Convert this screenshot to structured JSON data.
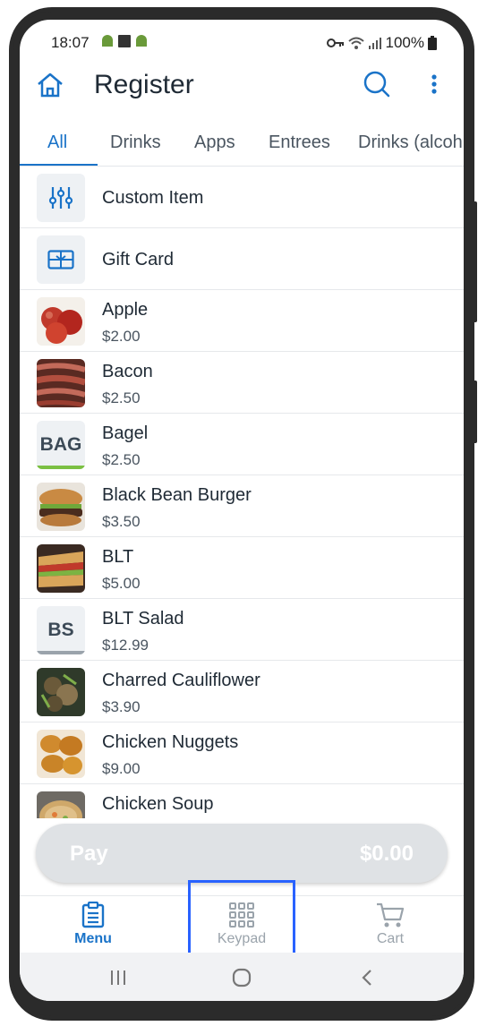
{
  "status_bar": {
    "time": "18:07",
    "battery": "100%"
  },
  "header": {
    "title": "Register"
  },
  "tabs": [
    {
      "label": "All",
      "active": true
    },
    {
      "label": "Drinks",
      "active": false
    },
    {
      "label": "Apps",
      "active": false
    },
    {
      "label": "Entrees",
      "active": false
    },
    {
      "label": "Drinks (alcoh",
      "active": false
    }
  ],
  "items": [
    {
      "name": "Custom Item",
      "price": "",
      "thumb": "sliders-icon"
    },
    {
      "name": "Gift Card",
      "price": "",
      "thumb": "gift-card-icon"
    },
    {
      "name": "Apple",
      "price": "$2.00",
      "thumb": "apple-photo"
    },
    {
      "name": "Bacon",
      "price": "$2.50",
      "thumb": "bacon-photo"
    },
    {
      "name": "Bagel",
      "price": "$2.50",
      "thumb": "BAG"
    },
    {
      "name": "Black Bean Burger",
      "price": "$3.50",
      "thumb": "burger-photo"
    },
    {
      "name": "BLT",
      "price": "$5.00",
      "thumb": "blt-photo"
    },
    {
      "name": "BLT Salad",
      "price": "$12.99",
      "thumb": "BS"
    },
    {
      "name": "Charred Cauliflower",
      "price": "$3.90",
      "thumb": "cauliflower-photo"
    },
    {
      "name": "Chicken Nuggets",
      "price": "$9.00",
      "thumb": "nuggets-photo"
    },
    {
      "name": "Chicken Soup",
      "price": "",
      "thumb": "soup-photo"
    }
  ],
  "pay": {
    "label": "Pay",
    "amount": "$0.00"
  },
  "bottom_nav": [
    {
      "label": "Menu",
      "active": true
    },
    {
      "label": "Keypad",
      "active": false
    },
    {
      "label": "Cart",
      "active": false
    }
  ],
  "colors": {
    "accent": "#1a73c8",
    "highlight": "#2962ff",
    "bagel_bar": "#7bc043",
    "bs_bar": "#9aa3ab"
  }
}
